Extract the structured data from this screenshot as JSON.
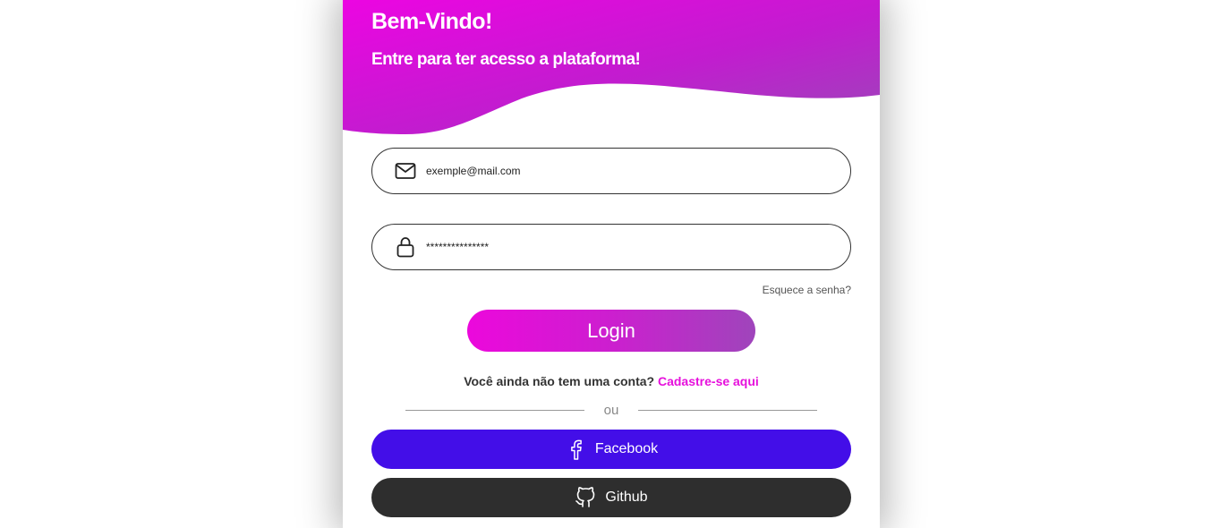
{
  "header": {
    "title": "Bem-Vindo!",
    "subtitle": "Entre para ter acesso a plataforma!"
  },
  "form": {
    "email": {
      "icon": "mail-icon",
      "value": "exemple@mail.com"
    },
    "password": {
      "icon": "lock-icon",
      "value": "***************"
    },
    "forgot_label": "Esquece a senha?",
    "login_label": "Login"
  },
  "signup": {
    "prompt": "Você ainda não tem uma conta?",
    "link_label": "Cadastre-se aqui"
  },
  "divider": {
    "label": "ou"
  },
  "social": {
    "facebook": {
      "icon": "facebook-icon",
      "label": "Facebook"
    },
    "github": {
      "icon": "github-icon",
      "label": "Github"
    }
  },
  "colors": {
    "accent_start": "#ec08dc",
    "accent_end": "#9f45bb",
    "facebook": "#430ee8",
    "github": "#2e2e2e",
    "signup_link": "#e610dc"
  }
}
